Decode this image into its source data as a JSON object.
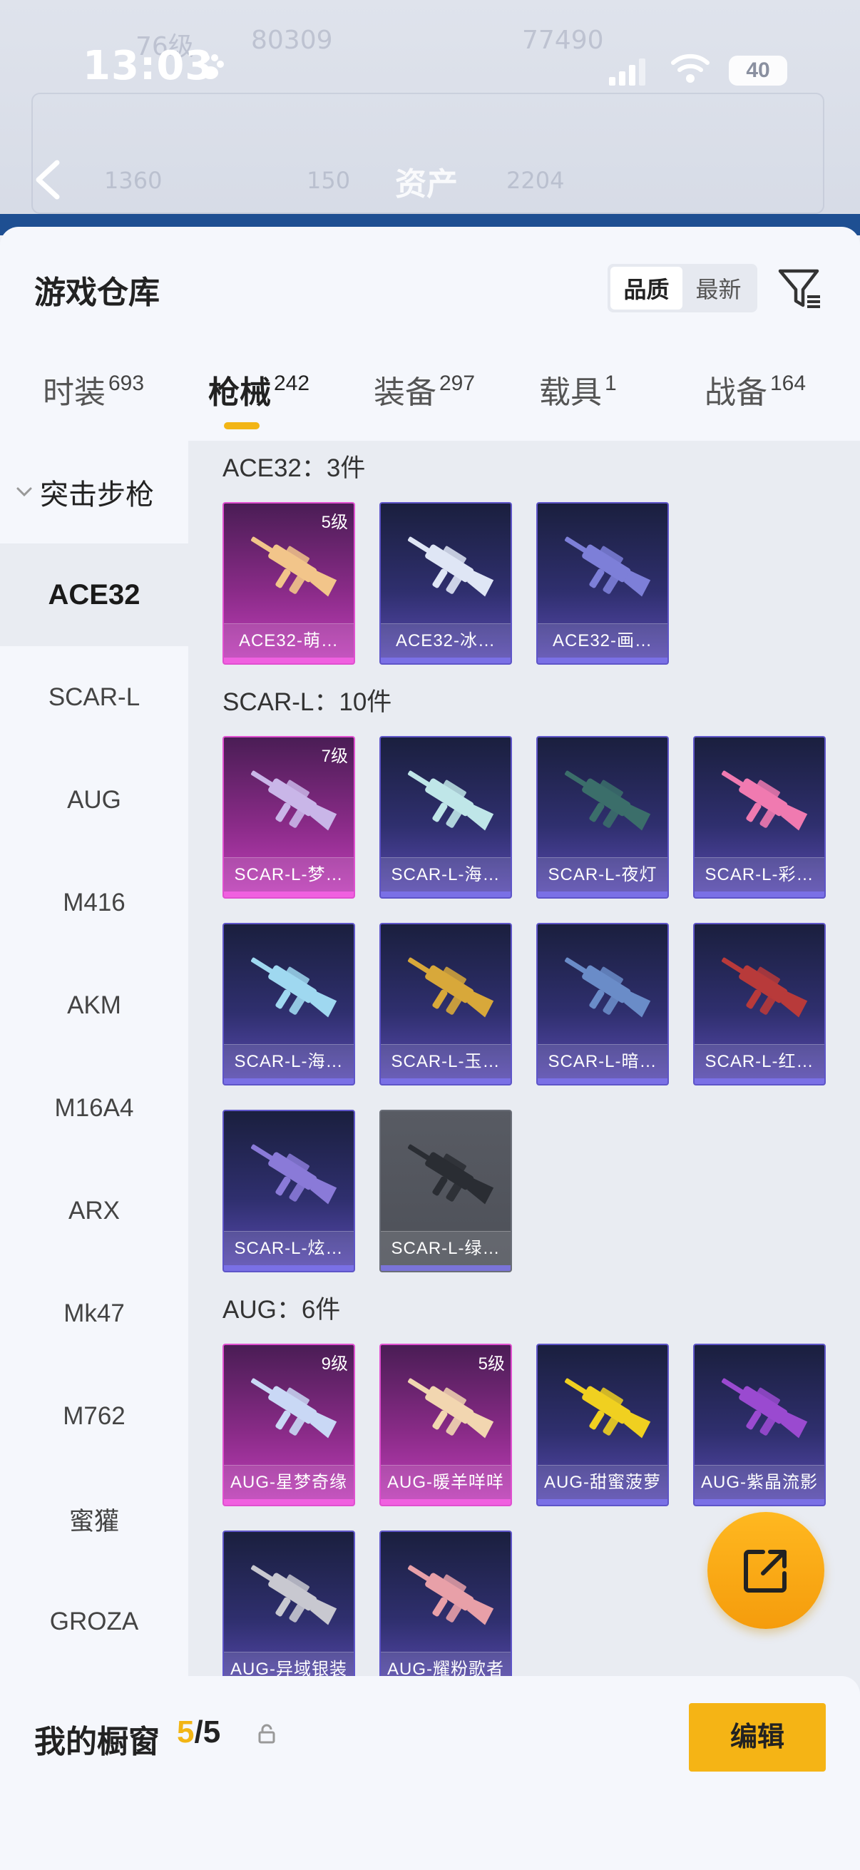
{
  "status_bar": {
    "time": "13:03",
    "battery": "40"
  },
  "background": {
    "title": "资产",
    "ghost_stats": [
      "76级",
      "80309",
      "77490",
      "1360",
      "150",
      "2204"
    ]
  },
  "header": {
    "title": "游戏仓库"
  },
  "sort": {
    "options": [
      "品质",
      "最新"
    ],
    "active": "品质"
  },
  "tabs": [
    {
      "label": "时装",
      "count": "693"
    },
    {
      "label": "枪械",
      "count": "242",
      "active": true
    },
    {
      "label": "装备",
      "count": "297"
    },
    {
      "label": "载具",
      "count": "1"
    },
    {
      "label": "战备",
      "count": "164"
    }
  ],
  "sidebar": {
    "group": "突击步枪",
    "items": [
      "ACE32",
      "SCAR-L",
      "AUG",
      "M416",
      "AKM",
      "M16A4",
      "ARX",
      "Mk47",
      "M762",
      "蜜獾",
      "GROZA"
    ],
    "active": "ACE32"
  },
  "sections": [
    {
      "title": "ACE32：3件",
      "cards": [
        {
          "name": "ACE32-萌…",
          "level": "5级",
          "rarity": "pink",
          "gun_color": "#f2c58a"
        },
        {
          "name": "ACE32-冰…",
          "level": "",
          "rarity": "purple",
          "gun_color": "#dfe6f5"
        },
        {
          "name": "ACE32-画…",
          "level": "",
          "rarity": "purple",
          "gun_color": "#7d7fd8"
        }
      ]
    },
    {
      "title": "SCAR-L：10件",
      "cards": [
        {
          "name": "SCAR-L-梦…",
          "level": "7级",
          "rarity": "pink",
          "gun_color": "#c9b6e8"
        },
        {
          "name": "SCAR-L-海…",
          "level": "",
          "rarity": "purple",
          "gun_color": "#bfe6e8"
        },
        {
          "name": "SCAR-L-夜灯",
          "level": "",
          "rarity": "purple",
          "gun_color": "#3b6e6a"
        },
        {
          "name": "SCAR-L-彩…",
          "level": "",
          "rarity": "purple",
          "gun_color": "#f07ab0"
        },
        {
          "name": "SCAR-L-海…",
          "level": "",
          "rarity": "purple",
          "gun_color": "#9fd8f0"
        },
        {
          "name": "SCAR-L-玉…",
          "level": "",
          "rarity": "purple",
          "gun_color": "#d8a83a"
        },
        {
          "name": "SCAR-L-暗…",
          "level": "",
          "rarity": "purple",
          "gun_color": "#6a8cc8"
        },
        {
          "name": "SCAR-L-红…",
          "level": "",
          "rarity": "purple",
          "gun_color": "#b83a3a"
        },
        {
          "name": "SCAR-L-炫…",
          "level": "",
          "rarity": "purple",
          "gun_color": "#8a7ad8"
        },
        {
          "name": "SCAR-L-绿…",
          "level": "",
          "rarity": "gray",
          "gun_color": "#2a2d33"
        }
      ]
    },
    {
      "title": "AUG：6件",
      "cards": [
        {
          "name": "AUG-星梦奇缘",
          "level": "9级",
          "rarity": "pink",
          "gun_color": "#c9d8f5"
        },
        {
          "name": "AUG-暖羊咩咩",
          "level": "5级",
          "rarity": "pink",
          "gun_color": "#f2d6b0"
        },
        {
          "name": "AUG-甜蜜菠萝",
          "level": "",
          "rarity": "purple",
          "gun_color": "#f0d020"
        },
        {
          "name": "AUG-紫晶流影",
          "level": "",
          "rarity": "purple",
          "gun_color": "#9a4ad0"
        },
        {
          "name": "AUG-异域银装",
          "level": "",
          "rarity": "purple",
          "gun_color": "#c8c8d0"
        },
        {
          "name": "AUG-耀粉歌者",
          "level": "",
          "rarity": "purple",
          "gun_color": "#e8a0a8"
        }
      ]
    }
  ],
  "bottom": {
    "label": "我的橱窗",
    "current": "5",
    "total": "/5",
    "edit_label": "编辑"
  }
}
